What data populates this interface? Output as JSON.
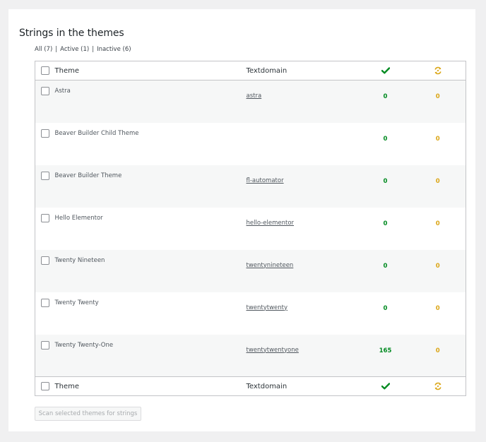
{
  "section": {
    "title": "Strings in the themes"
  },
  "filters": [
    {
      "label": "All (7)"
    },
    {
      "label": "Active (1)"
    },
    {
      "label": "Inactive (6)"
    }
  ],
  "table": {
    "columns": {
      "theme": "Theme",
      "textdomain": "Textdomain",
      "complete_icon": "checkmark-icon",
      "pending_icon": "sync-icon"
    },
    "rows": [
      {
        "name": "Astra",
        "textdomain": "astra",
        "complete": "0",
        "pending": "0"
      },
      {
        "name": "Beaver Builder Child Theme",
        "textdomain": "",
        "complete": "0",
        "pending": "0"
      },
      {
        "name": "Beaver Builder Theme",
        "textdomain": "fl-automator",
        "complete": "0",
        "pending": "0"
      },
      {
        "name": "Hello Elementor",
        "textdomain": "hello-elementor",
        "complete": "0",
        "pending": "0"
      },
      {
        "name": "Twenty Nineteen",
        "textdomain": "twentynineteen",
        "complete": "0",
        "pending": "0"
      },
      {
        "name": "Twenty Twenty",
        "textdomain": "twentytwenty",
        "complete": "0",
        "pending": "0"
      },
      {
        "name": "Twenty Twenty-One",
        "textdomain": "twentytwentyone",
        "complete": "165",
        "pending": "0"
      }
    ]
  },
  "scan_button": {
    "label": "Scan selected themes for strings"
  },
  "colors": {
    "complete": "#008a20",
    "pending": "#dba617"
  }
}
